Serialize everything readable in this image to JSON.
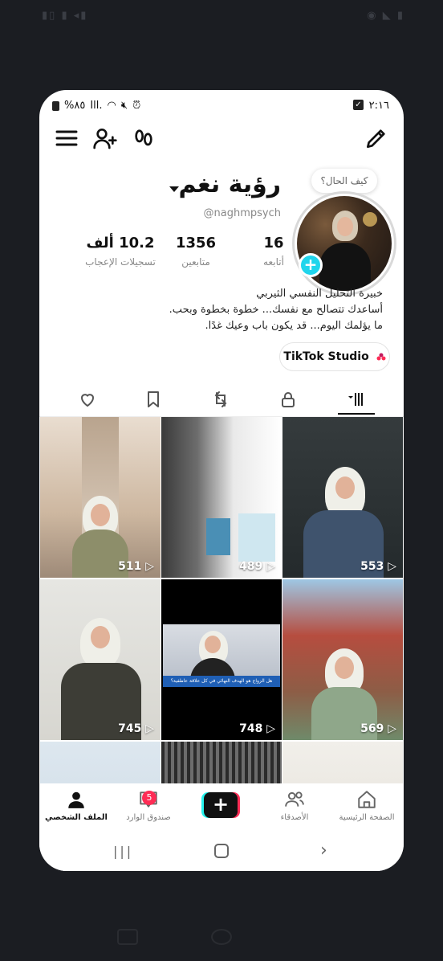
{
  "status_bar": {
    "time": "٢:١٦",
    "battery": "%٨٥"
  },
  "profile": {
    "name": "رؤية نغم",
    "handle": "@naghmpsych",
    "bubble": "كيف الحال؟",
    "bio": [
      "خبيرة التحليل النفسي الثيربي",
      "أساعدك تتصالح مع نفسك... خطوة بخطوة وبحب.",
      "ما يؤلمك اليوم... قد يكون باب وعيك غدًا."
    ]
  },
  "stats": {
    "following": {
      "value": "16",
      "label": "أتابعه"
    },
    "followers": {
      "value": "1356",
      "label": "متابعين"
    },
    "likes": {
      "value": "10.2 ألف",
      "label": "تسجيلات الإعجاب"
    }
  },
  "studio_button": {
    "label": "TikTok Studio"
  },
  "tabs": [
    {
      "icon": "grid-icon",
      "active": true
    },
    {
      "icon": "lock-icon"
    },
    {
      "icon": "repost-icon"
    },
    {
      "icon": "bookmark-icon"
    },
    {
      "icon": "heart-icon"
    }
  ],
  "videos": [
    {
      "views": "553"
    },
    {
      "views": "489"
    },
    {
      "views": "511"
    },
    {
      "views": "569"
    },
    {
      "views": "748"
    },
    {
      "views": "745"
    }
  ],
  "video_overlay_text": "هل الزواج هو الهدف النهائي في كل علاقة عاطفية؟",
  "bottom_nav": {
    "home": "الصفحة الرئيسية",
    "friends": "الأصدقاء",
    "inbox": "صندوق الوارد",
    "inbox_badge": "5",
    "profile": "الملف الشخصي"
  },
  "colors": {
    "accent_cyan": "#20d5ec",
    "accent_red": "#fe2c55",
    "outer_bg": "#1b1d22"
  }
}
